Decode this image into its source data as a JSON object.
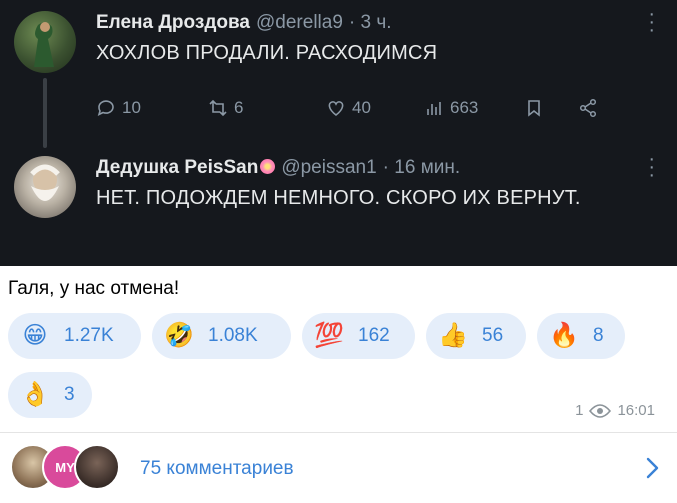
{
  "tweets": [
    {
      "author": "Елена Дроздова",
      "handle": "@derella9",
      "time": "· 3 ч.",
      "text": "ХОХЛОВ ПРОДАЛИ. РАСХОДИМСЯ",
      "replies": "10",
      "retweets": "6",
      "likes": "40",
      "views": "663"
    },
    {
      "author": "Дедушка PeisSan",
      "handle": "@peissan1",
      "time": "· 16 мин.",
      "text": "НЕТ. ПОДОЖДЕМ НЕМНОГО. СКОРО ИХ ВЕРНУТ."
    }
  ],
  "post": {
    "caption": "Галя, у нас отмена!",
    "reactions": [
      {
        "emoji": "😁",
        "count": "1.27K"
      },
      {
        "emoji": "🤣",
        "count": "1.08K"
      },
      {
        "emoji": "💯",
        "count": "162"
      },
      {
        "emoji": "👍",
        "count": "56"
      },
      {
        "emoji": "🔥",
        "count": "8"
      },
      {
        "emoji": "👌",
        "count": "3"
      }
    ],
    "views": "1",
    "time": "16:01",
    "comments_label": "75 комментариев",
    "commenter_badge": "MY"
  },
  "colors": {
    "accent": "#3a82d6",
    "chip_bg": "#e5eefa",
    "tweet_bg": "#15181d"
  }
}
